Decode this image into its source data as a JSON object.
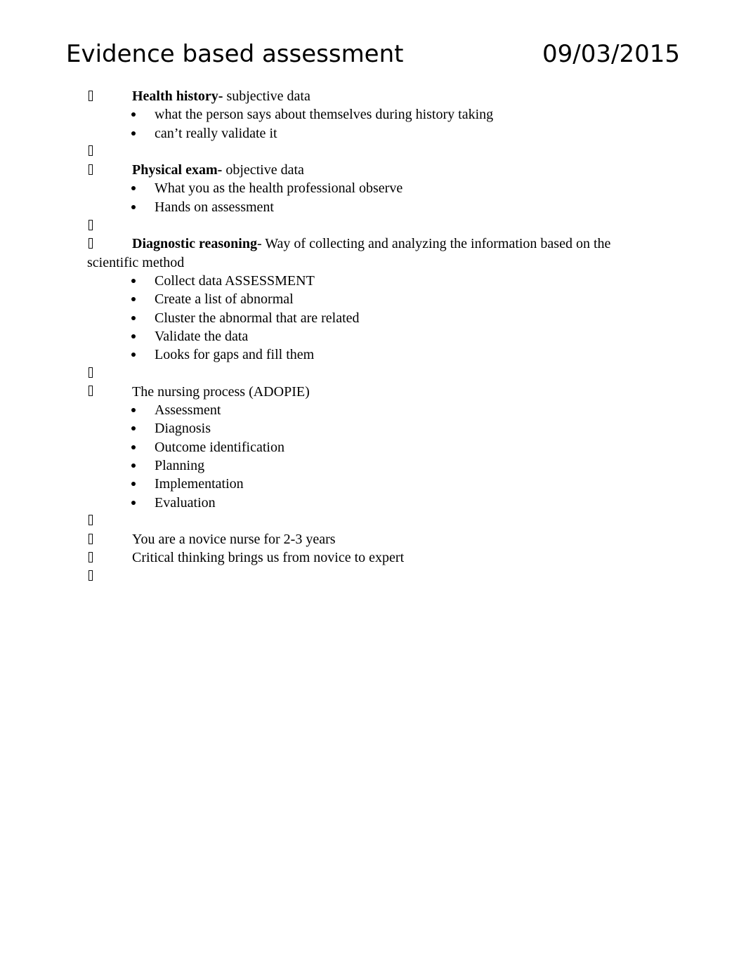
{
  "header": {
    "title": "Evidence based assessment",
    "date": "09/03/2015"
  },
  "icons": {
    "tofu": "missing-glyph-box",
    "dot": "filled-round-bullet"
  },
  "outline": {
    "item1": {
      "bold": "Health history-",
      "rest": " subjective data",
      "sub": [
        "what the person says about themselves during history taking",
        "can’t really validate it"
      ]
    },
    "item2": {
      "bold": "Physical exam-",
      "rest": " objective data",
      "sub": [
        "What you as the health professional observe",
        "Hands on assessment"
      ]
    },
    "item3": {
      "bold": "Diagnostic reasoning",
      "rest": "- Way of collecting and analyzing the information based on the scientific method",
      "sub": [
        "Collect data ASSESSMENT",
        "Create a list of abnormal",
        "Cluster the abnormal that are related",
        "Validate the data",
        "Looks for gaps and fill them"
      ]
    },
    "item4": {
      "text": "The nursing process (ADOPIE)",
      "sub": [
        "Assessment",
        "Diagnosis",
        "Outcome identification",
        "Planning",
        "Implementation",
        "Evaluation"
      ]
    },
    "item5": {
      "text": "You are a novice nurse for 2-3 years"
    },
    "item6": {
      "text": "Critical thinking brings us from novice to expert"
    }
  }
}
